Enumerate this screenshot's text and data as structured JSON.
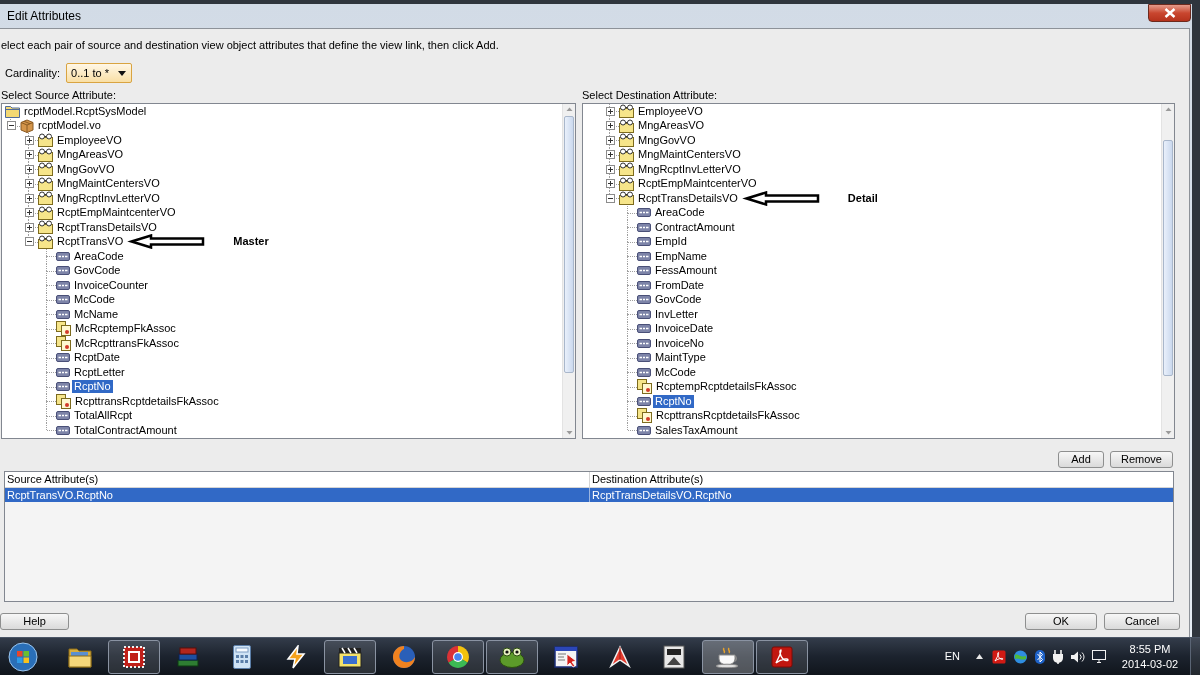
{
  "window": {
    "title": "Edit Attributes"
  },
  "instructions": "elect each pair of source and destination view object attributes that define the view link, then click Add.",
  "cardinality": {
    "label": "Cardinality:",
    "value": "0..1 to *"
  },
  "source": {
    "label": "Select Source Attribute:",
    "items": [
      {
        "kind": "model",
        "label": "rcptModel.RcptSysModel",
        "selected": false,
        "children": [
          {
            "kind": "package",
            "label": "rcptModel.vo",
            "expanded": true,
            "selected": false,
            "children": [
              {
                "kind": "view",
                "label": "EmployeeVO",
                "expanded": false,
                "selected": false
              },
              {
                "kind": "view",
                "label": "MngAreasVO",
                "expanded": false,
                "selected": false
              },
              {
                "kind": "view",
                "label": "MngGovVO",
                "expanded": false,
                "selected": false
              },
              {
                "kind": "view",
                "label": "MngMaintCentersVO",
                "expanded": false,
                "selected": false
              },
              {
                "kind": "view",
                "label": "MngRcptInvLetterVO",
                "expanded": false,
                "selected": false
              },
              {
                "kind": "view",
                "label": "RcptEmpMaintcenterVO",
                "expanded": false,
                "selected": false
              },
              {
                "kind": "view",
                "label": "RcptTransDetailsVO",
                "expanded": false,
                "selected": false
              },
              {
                "kind": "view",
                "label": "RcptTransVO",
                "expanded": true,
                "selected": false,
                "annotation": "Master",
                "children": [
                  {
                    "kind": "attribute",
                    "label": "AreaCode",
                    "selected": false
                  },
                  {
                    "kind": "attribute",
                    "label": "GovCode",
                    "selected": false
                  },
                  {
                    "kind": "attribute",
                    "label": "InvoiceCounter",
                    "selected": false
                  },
                  {
                    "kind": "attribute",
                    "label": "McCode",
                    "selected": false
                  },
                  {
                    "kind": "attribute",
                    "label": "McName",
                    "selected": false
                  },
                  {
                    "kind": "association",
                    "label": "McRcptempFkAssoc",
                    "selected": false
                  },
                  {
                    "kind": "association",
                    "label": "McRcpttransFkAssoc",
                    "selected": false
                  },
                  {
                    "kind": "attribute",
                    "label": "RcptDate",
                    "selected": false
                  },
                  {
                    "kind": "attribute",
                    "label": "RcptLetter",
                    "selected": false
                  },
                  {
                    "kind": "attribute",
                    "label": "RcptNo",
                    "selected": true
                  },
                  {
                    "kind": "association",
                    "label": "RcpttransRcptdetailsFkAssoc",
                    "selected": false
                  },
                  {
                    "kind": "attribute",
                    "label": "TotalAllRcpt",
                    "selected": false
                  },
                  {
                    "kind": "attribute",
                    "label": "TotalContractAmount",
                    "selected": false
                  }
                ]
              }
            ]
          }
        ]
      }
    ]
  },
  "destination": {
    "label": "Select Destination Attribute:",
    "items": [
      {
        "kind": "view",
        "label": "EmployeeVO",
        "expanded": false,
        "selected": false
      },
      {
        "kind": "view",
        "label": "MngAreasVO",
        "expanded": false,
        "selected": false
      },
      {
        "kind": "view",
        "label": "MngGovVO",
        "expanded": false,
        "selected": false
      },
      {
        "kind": "view",
        "label": "MngMaintCentersVO",
        "expanded": false,
        "selected": false
      },
      {
        "kind": "view",
        "label": "MngRcptInvLetterVO",
        "expanded": false,
        "selected": false
      },
      {
        "kind": "view",
        "label": "RcptEmpMaintcenterVO",
        "expanded": false,
        "selected": false
      },
      {
        "kind": "view",
        "label": "RcptTransDetailsVO",
        "expanded": true,
        "selected": false,
        "annotation": "Detail",
        "children": [
          {
            "kind": "attribute",
            "label": "AreaCode",
            "selected": false
          },
          {
            "kind": "attribute",
            "label": "ContractAmount",
            "selected": false
          },
          {
            "kind": "attribute",
            "label": "EmpId",
            "selected": false
          },
          {
            "kind": "attribute",
            "label": "EmpName",
            "selected": false
          },
          {
            "kind": "attribute",
            "label": "FessAmount",
            "selected": false
          },
          {
            "kind": "attribute",
            "label": "FromDate",
            "selected": false
          },
          {
            "kind": "attribute",
            "label": "GovCode",
            "selected": false
          },
          {
            "kind": "attribute",
            "label": "InvLetter",
            "selected": false
          },
          {
            "kind": "attribute",
            "label": "InvoiceDate",
            "selected": false
          },
          {
            "kind": "attribute",
            "label": "InvoiceNo",
            "selected": false
          },
          {
            "kind": "attribute",
            "label": "MaintType",
            "selected": false
          },
          {
            "kind": "attribute",
            "label": "McCode",
            "selected": false
          },
          {
            "kind": "association",
            "label": "RcptempRcptdetailsFkAssoc",
            "selected": false
          },
          {
            "kind": "attribute",
            "label": "RcptNo",
            "selected": true
          },
          {
            "kind": "association",
            "label": "RcpttransRcptdetailsFkAssoc",
            "selected": false
          },
          {
            "kind": "attribute",
            "label": "SalesTaxAmount",
            "selected": false
          }
        ]
      }
    ]
  },
  "list_buttons": [
    "Add",
    "Remove"
  ],
  "table": {
    "columns": [
      "Source Attribute(s)",
      "Destination Attribute(s)"
    ],
    "rows": [
      {
        "cells": [
          "RcptTransVO.RcptNo",
          "RcptTransDetailsVO.RcptNo"
        ],
        "selected": true
      }
    ]
  },
  "footer": {
    "left_buttons": [
      "Help"
    ],
    "right_buttons": [
      "OK",
      "Cancel"
    ]
  },
  "taskbar": {
    "apps": [
      {
        "kind": "folder",
        "running": false,
        "selected": false
      },
      {
        "kind": "square",
        "running": true,
        "selected": false
      },
      {
        "kind": "books",
        "running": false,
        "selected": false
      },
      {
        "kind": "calculator",
        "running": false,
        "selected": false
      },
      {
        "kind": "bolt",
        "running": false,
        "selected": false
      },
      {
        "kind": "clapper",
        "running": true,
        "selected": false
      },
      {
        "kind": "globe",
        "running": false,
        "selected": false
      },
      {
        "kind": "wheel",
        "running": true,
        "selected": false
      },
      {
        "kind": "frog",
        "running": true,
        "selected": false
      },
      {
        "kind": "window",
        "running": false,
        "selected": false
      },
      {
        "kind": "arrow",
        "running": false,
        "selected": false
      },
      {
        "kind": "tile",
        "running": false,
        "selected": false
      },
      {
        "kind": "cup",
        "running": true,
        "selected": true
      },
      {
        "kind": "swirl",
        "running": true,
        "selected": false
      }
    ],
    "language": "EN",
    "time": "8:55 PM",
    "date": "2014-03-02"
  }
}
